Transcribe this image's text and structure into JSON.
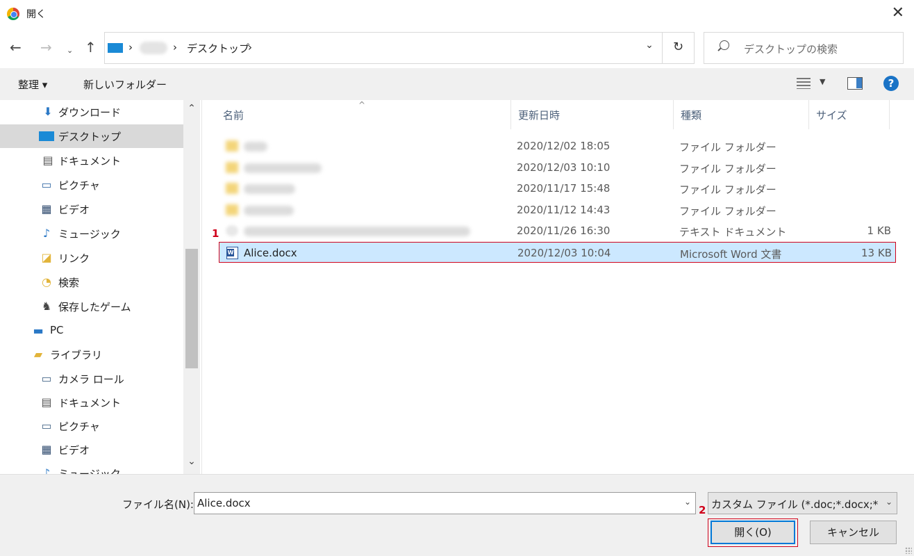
{
  "window": {
    "title": "開く"
  },
  "address": {
    "segments": [
      "デスクトップ"
    ],
    "search_placeholder": "デスクトップの検索"
  },
  "toolbar": {
    "organize": "整理 ▾",
    "new_folder": "新しいフォルダー"
  },
  "nav": {
    "items": [
      {
        "label": "ダウンロード",
        "icon": "download-icon"
      },
      {
        "label": "デスクトップ",
        "icon": "desktop-icon",
        "selected": true
      },
      {
        "label": "ドキュメント",
        "icon": "documents-icon"
      },
      {
        "label": "ピクチャ",
        "icon": "pictures-icon"
      },
      {
        "label": "ビデオ",
        "icon": "videos-icon"
      },
      {
        "label": "ミュージック",
        "icon": "music-icon"
      },
      {
        "label": "リンク",
        "icon": "links-icon"
      },
      {
        "label": "検索",
        "icon": "searches-icon"
      },
      {
        "label": "保存したゲーム",
        "icon": "saved-games-icon"
      },
      {
        "label": "PC",
        "icon": "pc-icon"
      },
      {
        "label": "ライブラリ",
        "icon": "library-icon"
      },
      {
        "label": "カメラ ロール",
        "icon": "camera-roll-icon"
      },
      {
        "label": "ドキュメント",
        "icon": "documents-icon"
      },
      {
        "label": "ピクチャ",
        "icon": "pictures-icon"
      },
      {
        "label": "ビデオ",
        "icon": "videos-icon"
      },
      {
        "label": "ミュージック",
        "icon": "music-icon"
      }
    ]
  },
  "columns": {
    "name": "名前",
    "date": "更新日時",
    "type": "種類",
    "size": "サイズ"
  },
  "files": [
    {
      "name": "",
      "date": "2020/12/02 18:05",
      "type": "ファイル フォルダー",
      "size": "",
      "kind": "folder"
    },
    {
      "name": "",
      "date": "2020/12/03 10:10",
      "type": "ファイル フォルダー",
      "size": "",
      "kind": "folder"
    },
    {
      "name": "",
      "date": "2020/11/17 15:48",
      "type": "ファイル フォルダー",
      "size": "",
      "kind": "folder"
    },
    {
      "name": "",
      "date": "2020/11/12 14:43",
      "type": "ファイル フォルダー",
      "size": "",
      "kind": "folder"
    },
    {
      "name": "",
      "date": "2020/11/26 16:30",
      "type": "テキスト ドキュメント",
      "size": "1 KB",
      "kind": "text"
    },
    {
      "name": "Alice.docx",
      "date": "2020/12/03 10:04",
      "type": "Microsoft Word 文書",
      "size": "13 KB",
      "kind": "word",
      "selected": true
    }
  ],
  "callouts": {
    "one": "1",
    "two": "2"
  },
  "footer": {
    "filename_label": "ファイル名(N):",
    "filename_value": "Alice.docx",
    "filter_value": "カスタム ファイル (*.doc;*.docx;*.pptx)",
    "open_button": "開く(O)",
    "cancel_button": "キャンセル"
  },
  "colors": {
    "accent": "#0078d7",
    "selection": "#cce8ff",
    "callout_red": "#d0021b",
    "word_blue": "#2b579a"
  }
}
